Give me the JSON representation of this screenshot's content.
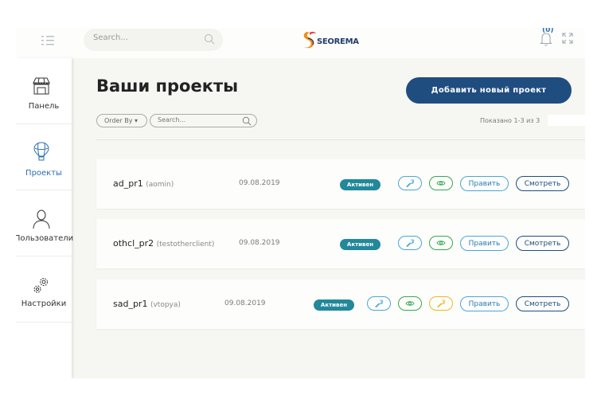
{
  "header": {
    "search_placeholder": "Search...",
    "logo_text": "SEOREMA",
    "notifications_count": "(0)"
  },
  "sidebar": {
    "items": [
      {
        "label": "Панель",
        "icon": "shop-icon",
        "active": false
      },
      {
        "label": "Проекты",
        "icon": "balloon-icon",
        "active": true
      },
      {
        "label": "Пользователи",
        "icon": "user-icon",
        "active": false
      },
      {
        "label": "Настройки",
        "icon": "gears-icon",
        "active": false
      }
    ]
  },
  "main": {
    "title": "Ваши проекты",
    "add_button": "Добавить новый проект",
    "order_by": "Order By",
    "filter_search_placeholder": "Search...",
    "shown_text": "Показано 1-3 из 3"
  },
  "projects": [
    {
      "name": "ad_pr1",
      "client": "(aomin)",
      "date": "09.08.2019",
      "status": "Активен",
      "tools": [
        "wrench",
        "eye"
      ],
      "edit": "Править",
      "view": "Смотреть"
    },
    {
      "name": "othcl_pr2",
      "client": "(testotherclient)",
      "date": "09.08.2019",
      "status": "Активен",
      "tools": [
        "wrench",
        "eye"
      ],
      "edit": "Править",
      "view": "Смотреть"
    },
    {
      "name": "sad_pr1",
      "client": "(vtopya)",
      "date": "09.08.2019",
      "status": "Активен",
      "tools": [
        "wrench",
        "eye",
        "wrench"
      ],
      "edit": "Править",
      "view": "Смотреть"
    }
  ],
  "colors": {
    "primary": "#204d80",
    "active_badge": "#22889a",
    "accent_blue": "#4aa6d8",
    "accent_green": "#34a853",
    "accent_yellow": "#f2b71e"
  }
}
